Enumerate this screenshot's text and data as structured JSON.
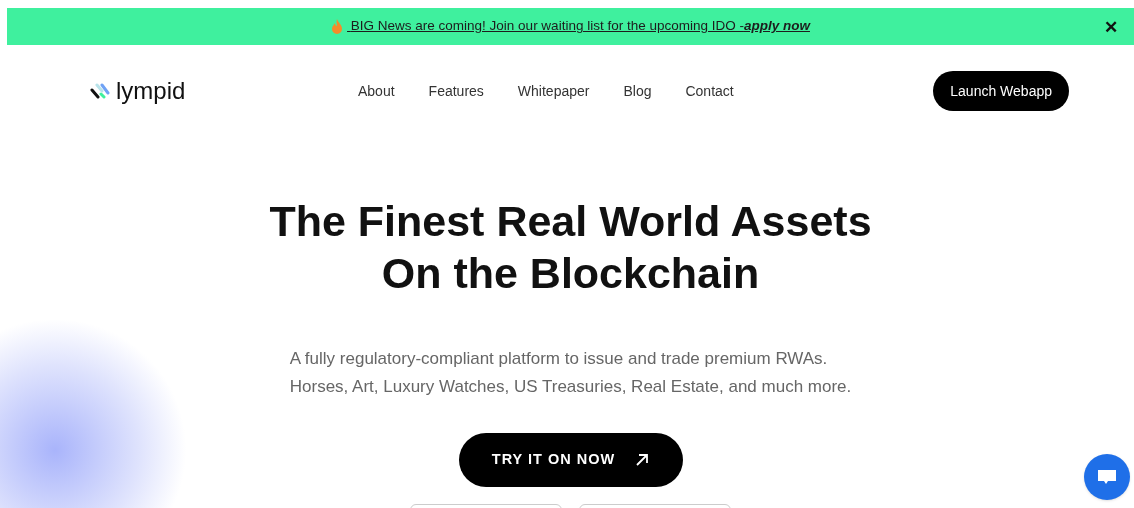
{
  "banner": {
    "text": "BIG News are coming! Join our waiting list for the upcoming IDO -",
    "link": "apply now",
    "close": "✕"
  },
  "nav": {
    "brand": "lympid",
    "links": [
      "About",
      "Features",
      "Whitepaper",
      "Blog",
      "Contact"
    ],
    "cta": "Launch Webapp"
  },
  "hero": {
    "title_lines": [
      "The Finest Real World Assets",
      "On the Blockchain"
    ],
    "subtitle_lines": [
      "A fully regulatory-compliant platform to issue and trade premium RWAs.",
      "Horses, Art, Luxury Watches, US Treasuries, Real Estate, and much more."
    ],
    "cta": "TRY IT ON NOW"
  }
}
